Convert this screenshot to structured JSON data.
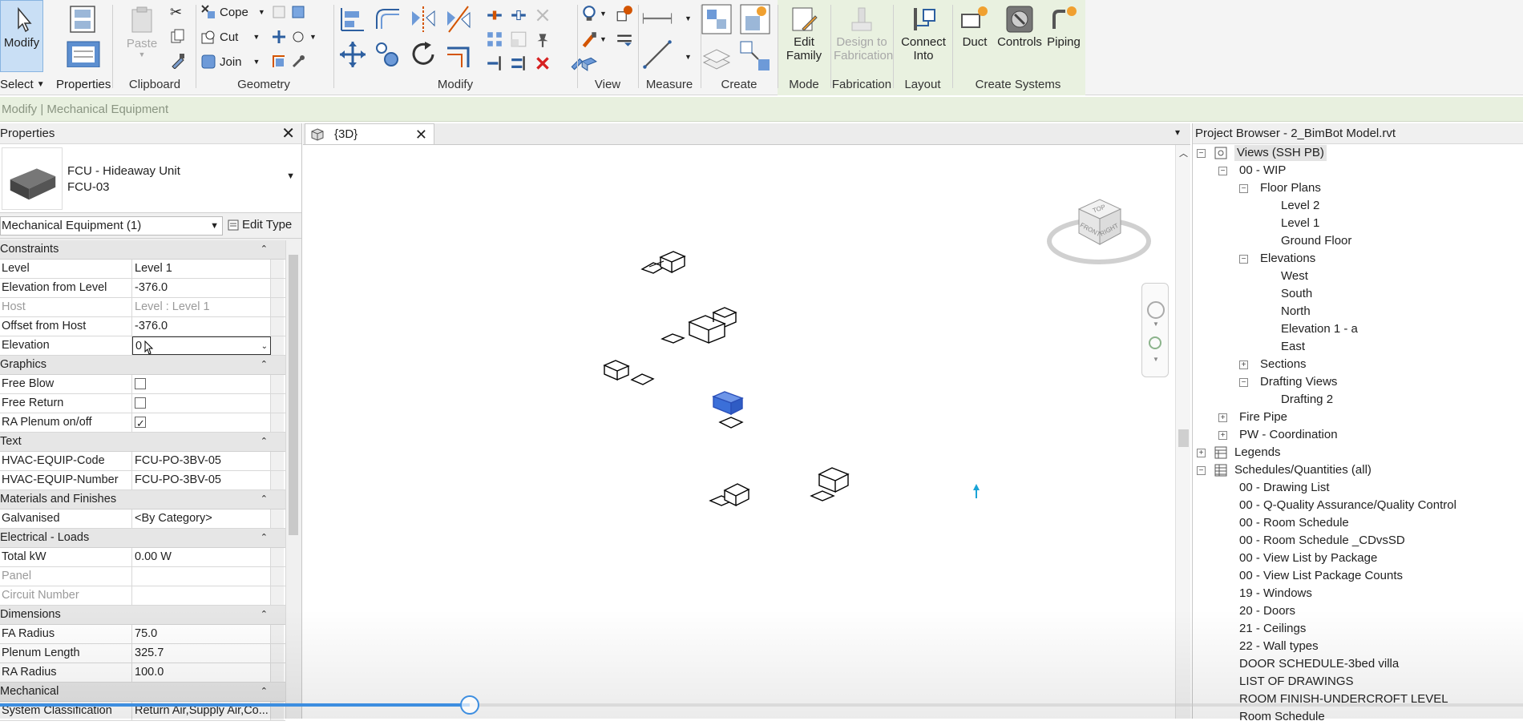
{
  "ribbon": {
    "modify_label": "Modify",
    "select_label": "Select",
    "properties_label": "Properties",
    "clipboard": {
      "label": "Clipboard",
      "paste": "Paste"
    },
    "geometry": {
      "label": "Geometry",
      "cope": "Cope",
      "cut": "Cut",
      "join": "Join"
    },
    "modify_group": {
      "label": "Modify"
    },
    "view_group": {
      "label": "View"
    },
    "measure_group": {
      "label": "Measure"
    },
    "create_group": {
      "label": "Create"
    },
    "mode": {
      "label": "Mode",
      "edit_family_1": "Edit",
      "edit_family_2": "Family"
    },
    "fabrication": {
      "label": "Fabrication",
      "design_1": "Design to",
      "design_2": "Fabrication"
    },
    "layout": {
      "label": "Layout",
      "connect_1": "Connect",
      "connect_2": "Into"
    },
    "create_systems": {
      "label": "Create Systems",
      "duct": "Duct",
      "controls": "Controls",
      "piping": "Piping"
    }
  },
  "context_bar": "Modify | Mechanical Equipment",
  "properties": {
    "title": "Properties",
    "type_name": "FCU - Hideaway Unit",
    "type_sub": "FCU-03",
    "filter": "Mechanical Equipment (1)",
    "edit_type": "Edit Type",
    "sections": {
      "constraints": "Constraints",
      "graphics": "Graphics",
      "text": "Text",
      "materials": "Materials and Finishes",
      "electrical": "Electrical - Loads",
      "dimensions": "Dimensions",
      "mechanical": "Mechanical"
    },
    "rows": {
      "level": {
        "k": "Level",
        "v": "Level 1"
      },
      "elev_from_level": {
        "k": "Elevation from Level",
        "v": "-376.0"
      },
      "host": {
        "k": "Host",
        "v": "Level : Level 1"
      },
      "offset_host": {
        "k": "Offset from Host",
        "v": "-376.0"
      },
      "elevation": {
        "k": "Elevation",
        "v": "0"
      },
      "free_blow": {
        "k": "Free Blow",
        "v": false
      },
      "free_return": {
        "k": "Free Return",
        "v": false
      },
      "ra_plenum": {
        "k": "RA Plenum on/off",
        "v": true
      },
      "hvac_code": {
        "k": "HVAC-EQUIP-Code",
        "v": "FCU-PO-3BV-05"
      },
      "hvac_number": {
        "k": "HVAC-EQUIP-Number",
        "v": "FCU-PO-3BV-05"
      },
      "galvanised": {
        "k": "Galvanised",
        "v": "<By Category>"
      },
      "total_kw": {
        "k": "Total kW",
        "v": "0.00 W"
      },
      "panel": {
        "k": "Panel",
        "v": ""
      },
      "circuit": {
        "k": "Circuit Number",
        "v": ""
      },
      "fa_radius": {
        "k": "FA Radius",
        "v": "75.0"
      },
      "plenum_length": {
        "k": "Plenum Length",
        "v": "325.7"
      },
      "ra_radius": {
        "k": "RA Radius",
        "v": "100.0"
      },
      "system_class": {
        "k": "System Classification",
        "v": "Return Air,Supply Air,Co..."
      }
    }
  },
  "view": {
    "tab_label": "{3D}",
    "viewcube": {
      "top": "TOP",
      "front": "FRONT",
      "right": "RIGHT"
    }
  },
  "browser": {
    "title": "Project Browser - 2_BimBot Model.rvt",
    "nodes": {
      "views": "Views (SSH PB)",
      "wip": "00 - WIP",
      "floor_plans": "Floor Plans",
      "level2": "Level 2",
      "level1": "Level 1",
      "ground": "Ground Floor",
      "elevations": "Elevations",
      "west": "West",
      "south": "South",
      "north": "North",
      "elev1a": "Elevation 1 - a",
      "east": "East",
      "sections": "Sections",
      "drafting_views": "Drafting Views",
      "drafting2": "Drafting 2",
      "fire_pipe": "Fire Pipe",
      "pw_coord": "PW - Coordination",
      "legends": "Legends",
      "schedules": "Schedules/Quantities (all)",
      "s1": "00 - Drawing List",
      "s2": "00 - Q-Quality Assurance/Quality Control",
      "s3": "00 - Room Schedule",
      "s4": "00 - Room Schedule _CDvsSD",
      "s5": "00 - View List by Package",
      "s6": "00 - View List Package Counts",
      "s7": "19 - Windows",
      "s8": "20 - Doors",
      "s9": "21 - Ceilings",
      "s10": "22 - Wall types",
      "s11": "DOOR SCHEDULE-3bed villa",
      "s12": "LIST OF DRAWINGS",
      "s13": "ROOM FINISH-UNDERCROFT LEVEL",
      "s14": "Room Schedule"
    }
  },
  "colors": {
    "selected_blue": "#3b6fd8",
    "accent": "#3d8ee0",
    "context_green": "#e8f0df"
  },
  "playback": {
    "progress_percent": 30.8
  }
}
